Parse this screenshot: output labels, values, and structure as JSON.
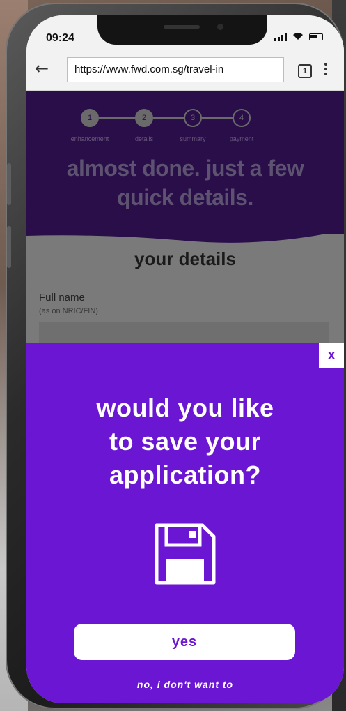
{
  "status_bar": {
    "time": "09:24",
    "icons": [
      "signal-icon",
      "wifi-icon",
      "battery-icon"
    ]
  },
  "browser": {
    "url": "https://www.fwd.com.sg/travel-in",
    "tab_count": "1"
  },
  "progress_steps": [
    {
      "number": "1",
      "label": "enhancement"
    },
    {
      "number": "2",
      "label": "details"
    },
    {
      "number": "3",
      "label": "summary"
    },
    {
      "number": "4",
      "label": "payment"
    }
  ],
  "hero": {
    "title_line1": "almost done. just a few",
    "title_line2": "quick details."
  },
  "form": {
    "section_title": "your details",
    "full_name_label": "Full name",
    "full_name_hint": "(as on NRIC/FIN)"
  },
  "modal": {
    "close_label": "x",
    "title_line1": "would you like",
    "title_line2": "to save your",
    "title_line3": "application?",
    "icon": "floppy-disk-icon",
    "yes_label": "yes",
    "no_label": "no, i don't want to"
  },
  "colors": {
    "modal_bg": "#6b16d2",
    "hero_bg": "#2a0e4a"
  }
}
